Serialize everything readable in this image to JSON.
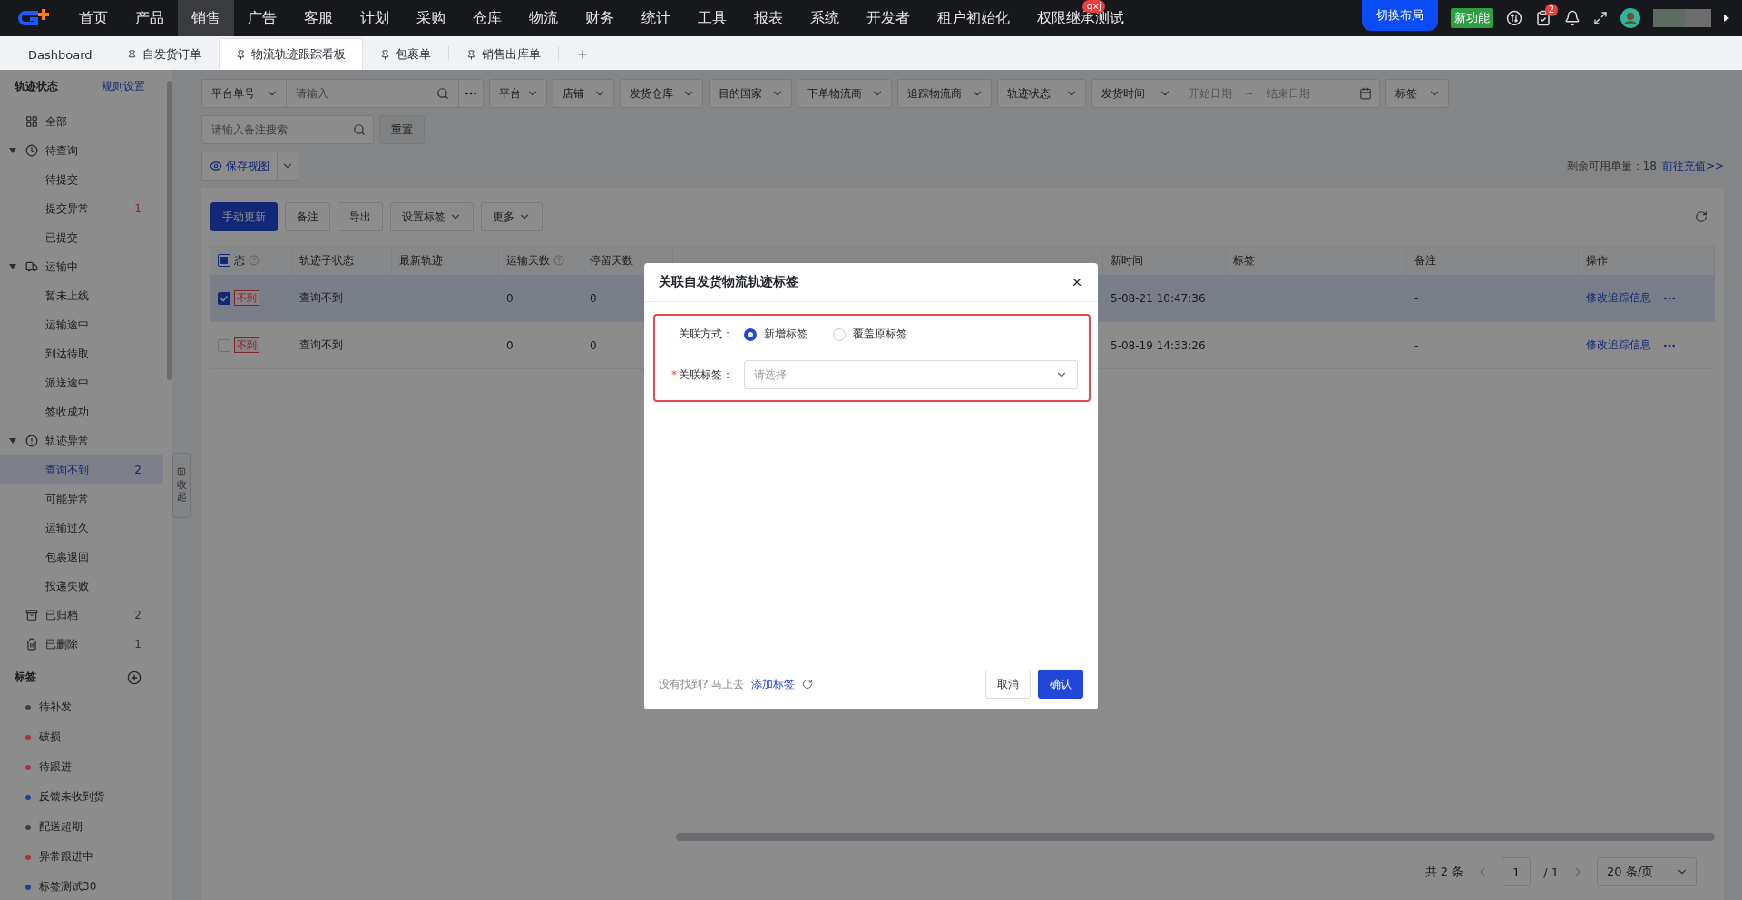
{
  "nav": {
    "items": [
      {
        "label": "首页",
        "selected": false
      },
      {
        "label": "产品",
        "selected": false
      },
      {
        "label": "销售",
        "selected": true
      },
      {
        "label": "广告",
        "selected": false
      },
      {
        "label": "客服",
        "selected": false
      },
      {
        "label": "计划",
        "selected": false
      },
      {
        "label": "采购",
        "selected": false
      },
      {
        "label": "仓库",
        "selected": false
      },
      {
        "label": "物流",
        "selected": false
      },
      {
        "label": "财务",
        "selected": false
      },
      {
        "label": "统计",
        "selected": false
      },
      {
        "label": "工具",
        "selected": false
      },
      {
        "label": "报表",
        "selected": false
      },
      {
        "label": "系统",
        "selected": false
      },
      {
        "label": "开发者",
        "selected": false
      },
      {
        "label": "租户初始化",
        "selected": false
      },
      {
        "label": "权限继承测试",
        "selected": false,
        "badge": "qxj"
      }
    ],
    "layout_button": "切换布局",
    "new_feature": "新功能",
    "task_count": "2"
  },
  "tabs": [
    {
      "label": "Dashboard",
      "pinned": false,
      "selected": false
    },
    {
      "label": "自发货订单",
      "pinned": true,
      "selected": false
    },
    {
      "label": "物流轨迹跟踪看板",
      "pinned": true,
      "selected": true
    },
    {
      "label": "包裹单",
      "pinned": true,
      "selected": false
    },
    {
      "label": "销售出库单",
      "pinned": true,
      "selected": false
    }
  ],
  "sidebar": {
    "title": "轨迹状态",
    "link": "规则设置",
    "items": [
      {
        "label": "全部",
        "selected": false
      },
      {
        "label": "待查询",
        "expanded": true,
        "selected": false,
        "children": [
          {
            "label": "待提交",
            "selected": false
          },
          {
            "label": "提交异常",
            "selected": false,
            "count": "1",
            "warning": true
          },
          {
            "label": "已提交",
            "selected": false
          }
        ]
      },
      {
        "label": "运输中",
        "expanded": true,
        "selected": false,
        "children": [
          {
            "label": "暂未上线",
            "selected": false
          },
          {
            "label": "运输途中",
            "selected": false
          },
          {
            "label": "到达待取",
            "selected": false
          },
          {
            "label": "派送途中",
            "selected": false
          },
          {
            "label": "签收成功",
            "selected": false
          }
        ]
      },
      {
        "label": "轨迹异常",
        "expanded": true,
        "selected": false,
        "children": [
          {
            "label": "查询不到",
            "selected": true,
            "count": "2",
            "warning": false
          },
          {
            "label": "可能异常",
            "selected": false
          },
          {
            "label": "运输过久",
            "selected": false
          },
          {
            "label": "包裹退回",
            "selected": false
          },
          {
            "label": "投递失败",
            "selected": false
          }
        ]
      },
      {
        "label": "已归档",
        "selected": false,
        "count": "2",
        "warning": false
      },
      {
        "label": "已删除",
        "selected": false,
        "count": "1",
        "warning": false
      }
    ],
    "tags_title": "标签",
    "tags": [
      {
        "label": "待补发",
        "color": "#3a3f4a"
      },
      {
        "label": "破损",
        "color": "#a8323a"
      },
      {
        "label": "待跟进",
        "color": "#a8323a"
      },
      {
        "label": "反馈未收到货",
        "color": "#243a9c"
      },
      {
        "label": "配送超期",
        "color": "#3a3f4a"
      },
      {
        "label": "异常跟进中",
        "color": "#a8323a"
      },
      {
        "label": "标签测试30",
        "color": "#243a9c"
      }
    ],
    "collapse": "收起"
  },
  "filters": {
    "order_type": "平台单号",
    "search_placeholder": "请输入",
    "selects": [
      "平台",
      "店铺",
      "发货仓库",
      "目的国家",
      "下单物流商",
      "追踪物流商",
      "轨迹状态"
    ],
    "date_type": "发货时间",
    "date_start": "开始日期",
    "date_sep": "~",
    "date_end": "结束日期",
    "tag_select": "标签",
    "remark_placeholder": "请输入备注搜索",
    "reset": "重置",
    "save_view": "保存视图",
    "quota_label": "剩余可用单量：",
    "quota": "18",
    "recharge": "前往充值>>"
  },
  "toolbar": {
    "buttons": [
      {
        "label": "手动更新",
        "kind": "primary"
      },
      {
        "label": "备注",
        "kind": "plain"
      },
      {
        "label": "导出",
        "kind": "plain"
      },
      {
        "label": "设置标签",
        "kind": "dropdown"
      },
      {
        "label": "更多",
        "kind": "dropdown"
      }
    ]
  },
  "table": {
    "header_checkbox": {
      "indeterminate": true
    },
    "columns": [
      "态",
      "轨迹子状态",
      "最新轨迹",
      "运输天数",
      "停留天数",
      "新时间",
      "标签",
      "备注",
      "操作"
    ],
    "rows": [
      {
        "selected": true,
        "status": "不到",
        "sub_status": "查询不到",
        "transit_days": "0",
        "stay_days": "0",
        "time": "5-08-21 10:47:36",
        "remark": "-",
        "action": "修改追踪信息"
      },
      {
        "selected": false,
        "status": "不到",
        "sub_status": "查询不到",
        "transit_days": "0",
        "stay_days": "0",
        "time": "5-08-19 14:33:26",
        "remark": "-",
        "action": "修改追踪信息"
      }
    ]
  },
  "pagination": {
    "total": "共 2 条",
    "page": "1",
    "pages": "/ 1",
    "page_size": "20 条/页"
  },
  "dialog": {
    "title": "关联自发货物流轨迹标签",
    "mode_label": "关联方式：",
    "modes": [
      {
        "label": "新增标签",
        "selected": true
      },
      {
        "label": "覆盖原标签",
        "selected": false
      }
    ],
    "required_mark": "*",
    "tag_label": "关联标签：",
    "tag_placeholder": "请选择",
    "hint": "没有找到? 马上去",
    "add_link": "添加标签",
    "cancel": "取消",
    "confirm": "确认"
  }
}
